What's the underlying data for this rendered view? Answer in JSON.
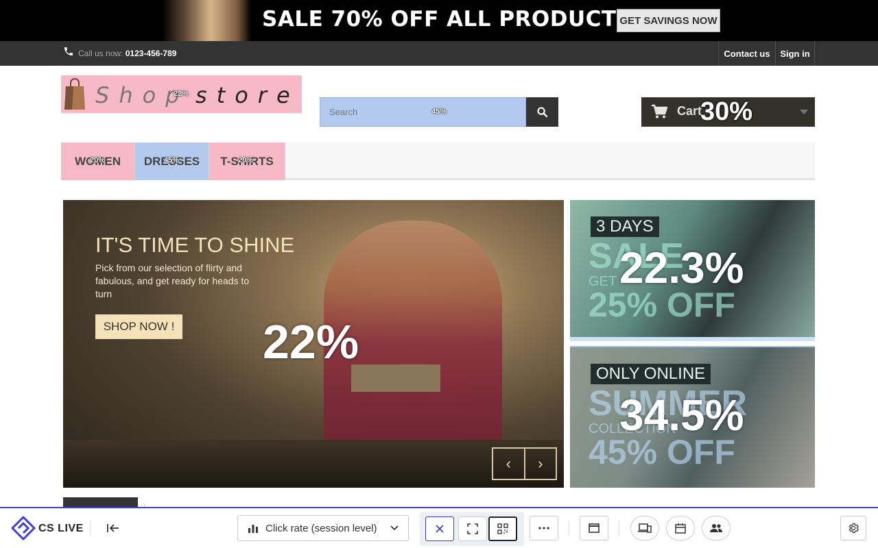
{
  "promo": {
    "text": "SALE 70% OFF ALL PRODUCTS",
    "button": "GET SAVINGS NOW"
  },
  "topbar": {
    "call_label": "Call us now:",
    "phone": "0123-456-789",
    "contact": "Contact us",
    "signin": "Sign in"
  },
  "logo": {
    "shop": "Shop",
    "store": "store",
    "pct": "22%"
  },
  "search": {
    "placeholder": "Search",
    "pct": "45%"
  },
  "cart": {
    "label": "Cart",
    "pct": "30%"
  },
  "nav": {
    "tabs": [
      {
        "label": "WOMEN",
        "pct": "20%",
        "color": "#f7b9c6"
      },
      {
        "label": "DRESSES",
        "pct": "45%",
        "color": "#b4c9ee"
      },
      {
        "label": "T-SHIRTS",
        "pct": "20%",
        "color": "#f7b9c6"
      }
    ]
  },
  "hero": {
    "title": "IT'S TIME TO SHINE",
    "text": "Pick from our selection of flirty and fabulous, and get ready for heads to turn",
    "button": "SHOP NOW !",
    "pct": "22%"
  },
  "banner1": {
    "tag": "3 DAYS",
    "ghost_big": "SALE",
    "ghost_small": "GET",
    "ghost_off": "25% OFF",
    "pct": "22.3%"
  },
  "banner2": {
    "tag": "ONLY ONLINE",
    "ghost_big": "SUMMER",
    "ghost_small": "COLLECTION",
    "ghost_off": "45% OFF",
    "pct": "34.5%"
  },
  "toolbar": {
    "brand": "CS LIVE",
    "metric": "Click rate (session level)"
  },
  "colors": {
    "accent": "#3d3fd2",
    "heat_pink": "#f7b9c6",
    "heat_blue": "#b4c9ee"
  },
  "icons": [
    "phone-icon",
    "bag-icon",
    "search-icon",
    "cart-icon",
    "chevron-left-icon",
    "chevron-right-icon",
    "cs-logo-icon",
    "collapse-left-icon",
    "bar-chart-icon",
    "chevron-down-icon",
    "close-icon",
    "fullscreen-icon",
    "qr-grid-icon",
    "more-icon",
    "window-icon",
    "devices-icon",
    "calendar-icon",
    "users-icon",
    "gear-icon"
  ]
}
